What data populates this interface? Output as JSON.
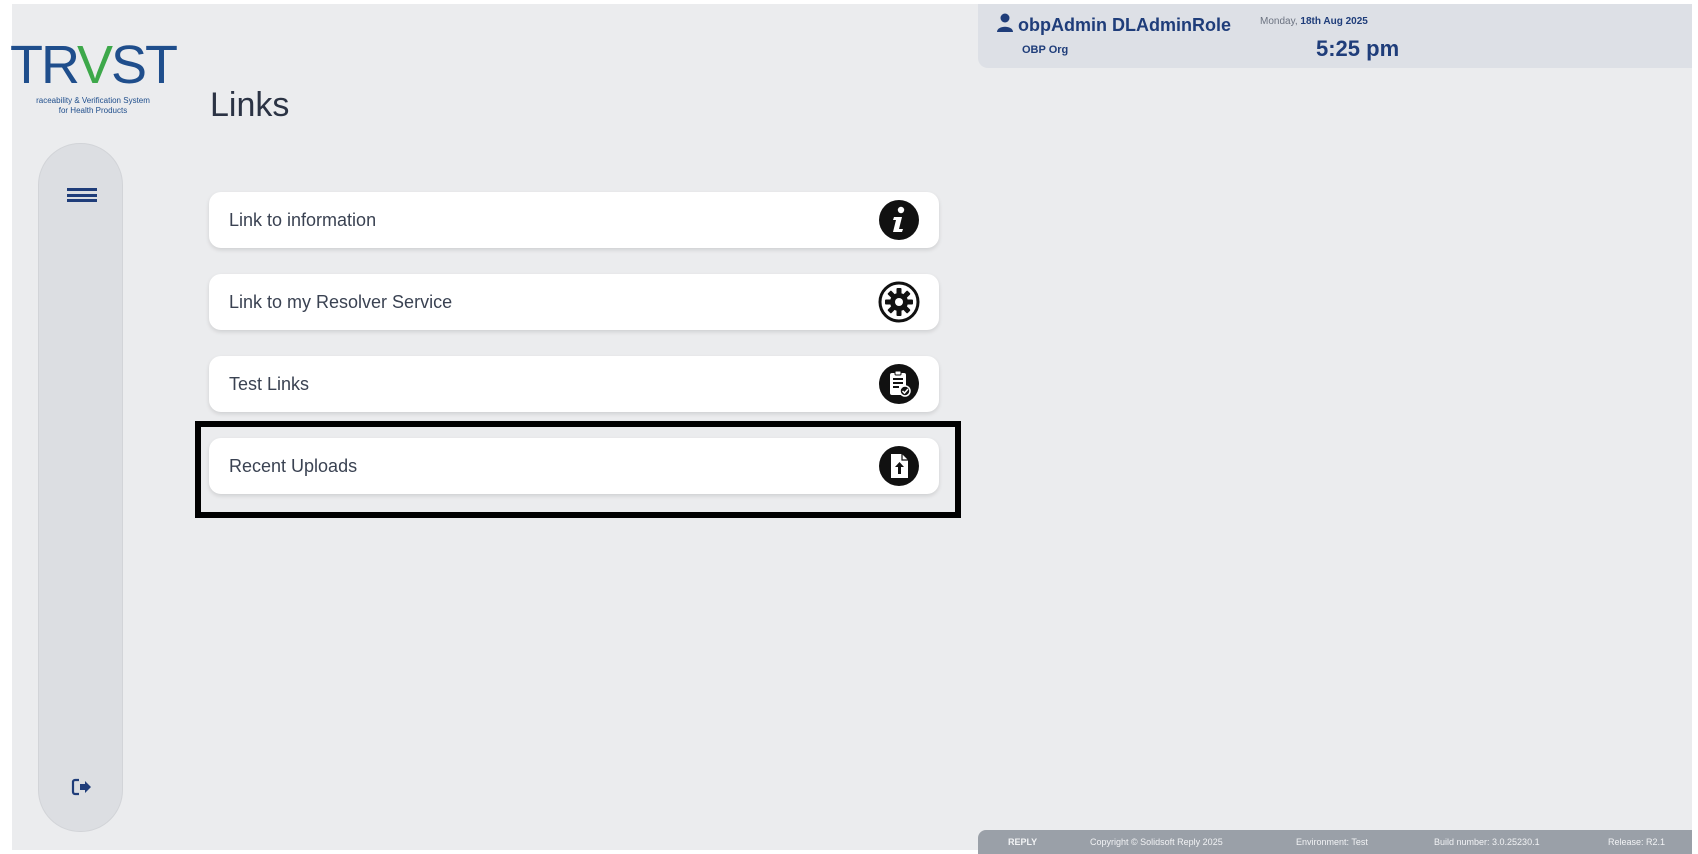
{
  "logo": {
    "wordmark_start": "TR",
    "wordmark_v": "V",
    "wordmark_end": "ST",
    "tagline_line1": "raceability & Verification System",
    "tagline_line2": "for Health Products"
  },
  "page": {
    "title": "Links"
  },
  "sidebar": {
    "menu_icon": "grid-menu-icon",
    "logout_icon": "logout-icon"
  },
  "links": [
    {
      "label": "Link to information",
      "icon": "info-icon"
    },
    {
      "label": "Link to my Resolver Service",
      "icon": "gear-icon"
    },
    {
      "label": "Test Links",
      "icon": "clipboard-check-icon"
    },
    {
      "label": "Recent Uploads",
      "icon": "file-upload-icon"
    }
  ],
  "user": {
    "name": "obpAdmin DLAdminRole",
    "org": "OBP Org",
    "day": "Monday,",
    "date": "18th Aug 2025",
    "time": "5:25 pm"
  },
  "footer": {
    "brand": "REPLY",
    "copyright": "Copyright © Solidsoft Reply 2025",
    "environment": "Environment: Test",
    "build": "Build number: 3.0.25230.1",
    "release": "Release: R2.1"
  },
  "colors": {
    "brand_blue": "#1f4e8c",
    "brand_green": "#3da84a",
    "background": "#ebecee"
  }
}
